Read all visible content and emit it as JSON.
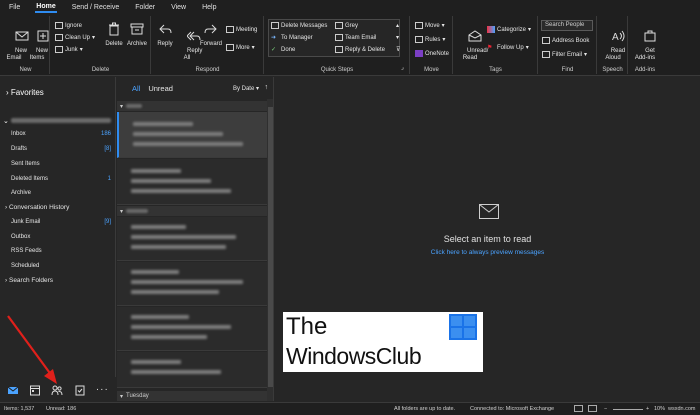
{
  "tabs": [
    "File",
    "Home",
    "Send / Receive",
    "Folder",
    "View",
    "Help"
  ],
  "ribbon": {
    "new": {
      "new_email": "New\nEmail",
      "new_items": "New\nItems",
      "label": "New"
    },
    "delete": {
      "ignore": "Ignore",
      "cleanup": "Clean Up",
      "junk": "Junk",
      "delete": "Delete",
      "archive": "Archive",
      "label": "Delete"
    },
    "respond": {
      "reply": "Reply",
      "reply_all": "Reply\nAll",
      "forward": "Forward",
      "meeting": "Meeting",
      "more": "More",
      "label": "Respond"
    },
    "quicksteps": {
      "items_left": [
        "Delete Messages",
        "To Manager",
        "Done"
      ],
      "items_right": [
        "Grey",
        "Team Email",
        "Reply & Delete"
      ],
      "label": "Quick Steps"
    },
    "move": {
      "move": "Move",
      "rules": "Rules",
      "onenote": "OneNote",
      "label": "Move"
    },
    "tags": {
      "unread_read": "Unread/\nRead",
      "categorize": "Categorize",
      "follow_up": "Follow Up",
      "label": "Tags"
    },
    "find": {
      "search_people": "Search People",
      "address_book": "Address Book",
      "filter_email": "Filter Email",
      "label": "Find"
    },
    "speech": {
      "read_aloud": "Read\nAloud",
      "label": "Speech"
    },
    "addins": {
      "get_addins": "Get\nAdd-ins",
      "label": "Add-ins"
    }
  },
  "folders": {
    "favorites": "Favorites",
    "items": [
      {
        "name": "Inbox",
        "count": "186"
      },
      {
        "name": "Drafts",
        "count": "[8]"
      },
      {
        "name": "Sent Items",
        "count": ""
      },
      {
        "name": "Deleted Items",
        "count": "1"
      },
      {
        "name": "Archive",
        "count": ""
      }
    ],
    "conversation_history": "Conversation History",
    "items2": [
      {
        "name": "Junk Email",
        "count": "[9]"
      },
      {
        "name": "Outbox",
        "count": ""
      },
      {
        "name": "RSS Feeds",
        "count": ""
      },
      {
        "name": "Scheduled",
        "count": ""
      }
    ],
    "search_folders": "Search Folders"
  },
  "message_list": {
    "tab_all": "All",
    "tab_unread": "Unread",
    "sort": "By Date",
    "sort_arrow": "↑",
    "tuesday": "Tuesday"
  },
  "reading_pane": {
    "select_text": "Select an item to read",
    "preview_link": "Click here to always preview messages"
  },
  "watermark": {
    "line1": "The",
    "line2": "WindowsClub"
  },
  "statusbar": {
    "items": "Items: 1,537",
    "unread": "Unread: 186",
    "folders_status": "All folders are up to date.",
    "connected": "Connected to: Microsoft Exchange",
    "zoom": "10%",
    "corner": "wsxdn.com"
  },
  "colors": {
    "accent": "#2f8cf0",
    "link": "#4ba3ff",
    "arrow": "#e0201b"
  }
}
